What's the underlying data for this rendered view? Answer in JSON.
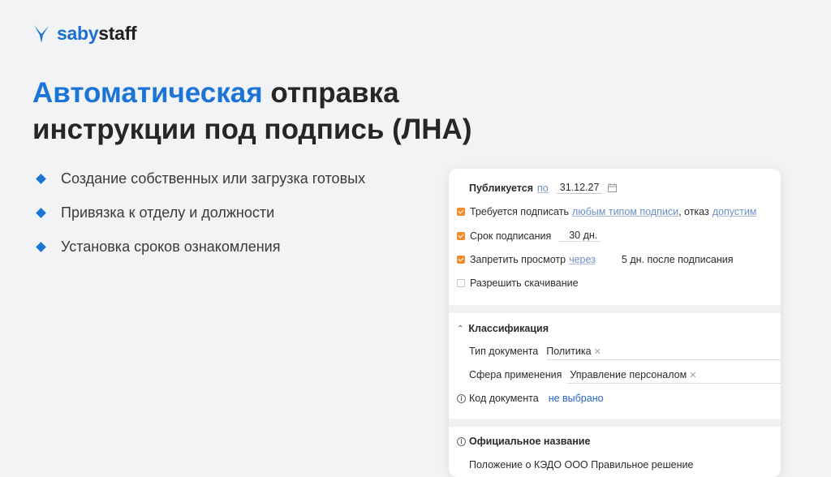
{
  "logo": {
    "saby": "saby",
    "staff": "staff"
  },
  "title": {
    "accent": "Автоматическая",
    "rest_line1": " отправка",
    "line2": "инструкции под подпись (ЛНА)"
  },
  "bullets": [
    "Создание собственных или загрузка готовых",
    "Привязка к отделу и должности",
    "Установка сроков ознакомления"
  ],
  "form": {
    "publish": {
      "label": "Публикуется",
      "by": "по",
      "date": "31.12.27"
    },
    "signing": {
      "label": "Требуется подписать",
      "type_link": "любым типом подписи",
      "refuse_text": ", отказ",
      "refuse_link": "допустим"
    },
    "term": {
      "label": "Срок подписания",
      "value": "30 дн."
    },
    "forbid": {
      "label": "Запретить просмотр",
      "link": "через",
      "value": "5 дн. после подписания"
    },
    "download": {
      "label": "Разрешить скачивание"
    },
    "classification": {
      "heading": "Классификация",
      "doc_type_label": "Тип документа",
      "doc_type_value": "Политика",
      "scope_label": "Сфера применения",
      "scope_value": "Управление персоналом",
      "code_label": "Код документа",
      "code_value": "не выбрано"
    },
    "official": {
      "heading": "Официальное название",
      "value": "Положение о КЭДО ООО Правильное решение"
    }
  },
  "colors": {
    "accent": "#1b74d6",
    "checkbox": "#f08c2e",
    "background": "#f2f3f5"
  }
}
